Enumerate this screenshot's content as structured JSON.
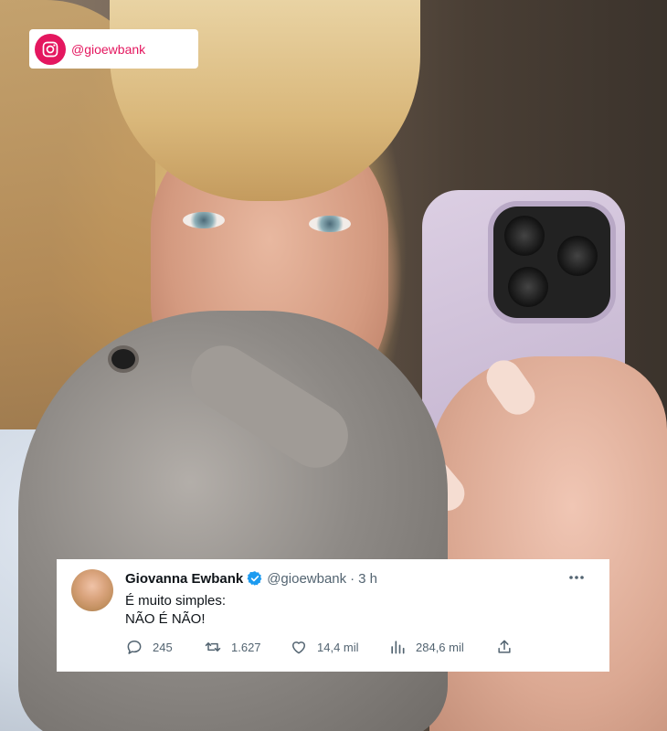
{
  "instagram_tag": {
    "handle": "@gioewbank",
    "icon": "instagram-icon",
    "color": "#e4175f"
  },
  "tweet": {
    "display_name": "Giovanna Ewbank",
    "verified": true,
    "handle": "@gioewbank",
    "separator": "·",
    "time": "3 h",
    "more_icon": "more-dots-icon",
    "text_line1": "É muito simples:",
    "text_line2": "NÃO É NÃO!",
    "actions": {
      "replies": "245",
      "retweets": "1.627",
      "likes": "14,4 mil",
      "views": "284,6 mil"
    },
    "colors": {
      "verified": "#1d9bf0",
      "text": "#0f1419",
      "secondary": "#536471"
    }
  }
}
